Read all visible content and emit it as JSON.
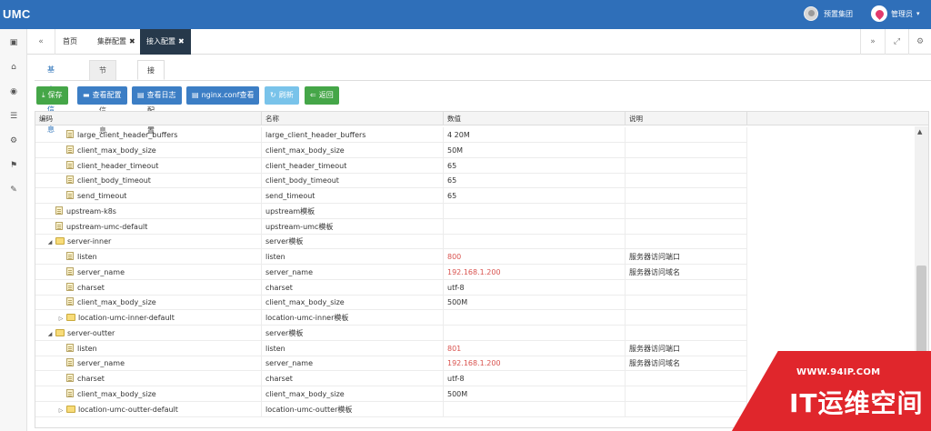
{
  "app": {
    "logo": "UMC"
  },
  "header": {
    "org_name": "预置集团",
    "user_name": "管理员",
    "user_caret": "▾"
  },
  "tabs": {
    "prev_icon": "«",
    "items": [
      {
        "label": "首页",
        "closable": false
      },
      {
        "label": "集群配置",
        "closable": true
      },
      {
        "label": "接入配置",
        "closable": true,
        "active": true
      }
    ],
    "close_glyph": "✖",
    "next_icon": "»",
    "fullscreen_icon": "⤢",
    "settings_icon": "⚙"
  },
  "subtabs": [
    "基本信息",
    "节点信息",
    "接入配置"
  ],
  "toolbar": [
    {
      "label": "保存",
      "icon": "⤓",
      "color": "green"
    },
    {
      "label": "查看配置",
      "icon": "▬",
      "color": "blue"
    },
    {
      "label": "查看日志",
      "icon": "▤",
      "color": "blue"
    },
    {
      "label": "nginx.conf查看",
      "icon": "▤",
      "color": "blue"
    },
    {
      "label": "刷新",
      "icon": "↻",
      "color": "lblue"
    },
    {
      "label": "返回",
      "icon": "⇐",
      "color": "green"
    }
  ],
  "grid": {
    "columns": [
      "编码",
      "名称",
      "数值",
      "说明"
    ],
    "rows": [
      {
        "code": "large_client_header_buffers",
        "name": "large_client_header_buffers",
        "value": "4 20M",
        "desc": "",
        "type": "file",
        "level": 2
      },
      {
        "code": "client_max_body_size",
        "name": "client_max_body_size",
        "value": "50M",
        "desc": "",
        "type": "file",
        "level": 2
      },
      {
        "code": "client_header_timeout",
        "name": "client_header_timeout",
        "value": "65",
        "desc": "",
        "type": "file",
        "level": 2
      },
      {
        "code": "client_body_timeout",
        "name": "client_body_timeout",
        "value": "65",
        "desc": "",
        "type": "file",
        "level": 2
      },
      {
        "code": "send_timeout",
        "name": "send_timeout",
        "value": "65",
        "desc": "",
        "type": "file",
        "level": 2
      },
      {
        "code": "upstream-k8s",
        "name": "upstream模板",
        "value": "",
        "desc": "",
        "type": "file",
        "level": 1
      },
      {
        "code": "upstream-umc-default",
        "name": "upstream-umc模板",
        "value": "",
        "desc": "",
        "type": "file",
        "level": 1
      },
      {
        "code": "server-inner",
        "name": "server模板",
        "value": "",
        "desc": "",
        "type": "folder-open",
        "level": 1
      },
      {
        "code": "listen",
        "name": "listen",
        "value": "800",
        "desc": "服务器访问端口",
        "type": "file",
        "level": 2,
        "highlight": true
      },
      {
        "code": "server_name",
        "name": "server_name",
        "value": "192.168.1.200",
        "desc": "服务器访问域名",
        "type": "file",
        "level": 2,
        "highlight": true
      },
      {
        "code": "charset",
        "name": "charset",
        "value": "utf-8",
        "desc": "",
        "type": "file",
        "level": 2
      },
      {
        "code": "client_max_body_size",
        "name": "client_max_body_size",
        "value": "500M",
        "desc": "",
        "type": "file",
        "level": 2
      },
      {
        "code": "location-umc-inner-default",
        "name": "location-umc-inner模板",
        "value": "",
        "desc": "",
        "type": "folder-closed",
        "level": 2
      },
      {
        "code": "server-outter",
        "name": "server模板",
        "value": "",
        "desc": "",
        "type": "folder-open",
        "level": 1
      },
      {
        "code": "listen",
        "name": "listen",
        "value": "801",
        "desc": "服务器访问端口",
        "type": "file",
        "level": 2,
        "highlight": true
      },
      {
        "code": "server_name",
        "name": "server_name",
        "value": "192.168.1.200",
        "desc": "服务器访问域名",
        "type": "file",
        "level": 2,
        "highlight": true
      },
      {
        "code": "charset",
        "name": "charset",
        "value": "utf-8",
        "desc": "",
        "type": "file",
        "level": 2
      },
      {
        "code": "client_max_body_size",
        "name": "client_max_body_size",
        "value": "500M",
        "desc": "",
        "type": "file",
        "level": 2
      },
      {
        "code": "location-umc-outter-default",
        "name": "location-umc-outter模板",
        "value": "",
        "desc": "",
        "type": "folder-closed",
        "level": 2
      }
    ]
  },
  "watermark": {
    "url": "WWW.94IP.COM",
    "title": "IT运维空间"
  },
  "colors": {
    "header": "#2f6fb9",
    "active_tab": "#27394b",
    "green": "#45a648",
    "blue": "#3c7ec5",
    "light_blue": "#79c3ea",
    "highlight_value": "#d9534f",
    "watermark": "#e0262c"
  }
}
